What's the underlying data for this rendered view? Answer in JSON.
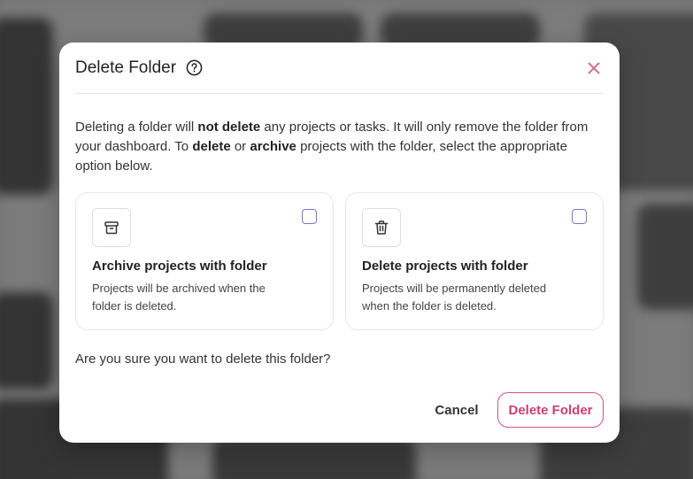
{
  "modal": {
    "title": "Delete Folder",
    "help_icon": "help-circle-icon",
    "close_icon": "close-icon",
    "description": {
      "p1": "Deleting a folder will ",
      "b1": "not delete",
      "p2": " any projects or tasks. It will only remove the folder from your dashboard. To ",
      "b2": "delete",
      "p3": " or ",
      "b3": "archive",
      "p4": " projects with the folder, select the appropriate option below."
    },
    "options": [
      {
        "icon": "archive-icon",
        "title": "Archive projects with folder",
        "description": "Projects will be archived when the folder is deleted.",
        "checked": false
      },
      {
        "icon": "trash-icon",
        "title": "Delete projects with folder",
        "description": "Projects will be permanently deleted when the folder is deleted.",
        "checked": false
      }
    ],
    "confirm_text": "Are you sure you want to delete this folder?",
    "cancel_label": "Cancel",
    "delete_label": "Delete Folder"
  },
  "colors": {
    "accent": "#cf3d73",
    "checkbox_border": "#7a77c7",
    "close_icon": "#d4708f"
  }
}
